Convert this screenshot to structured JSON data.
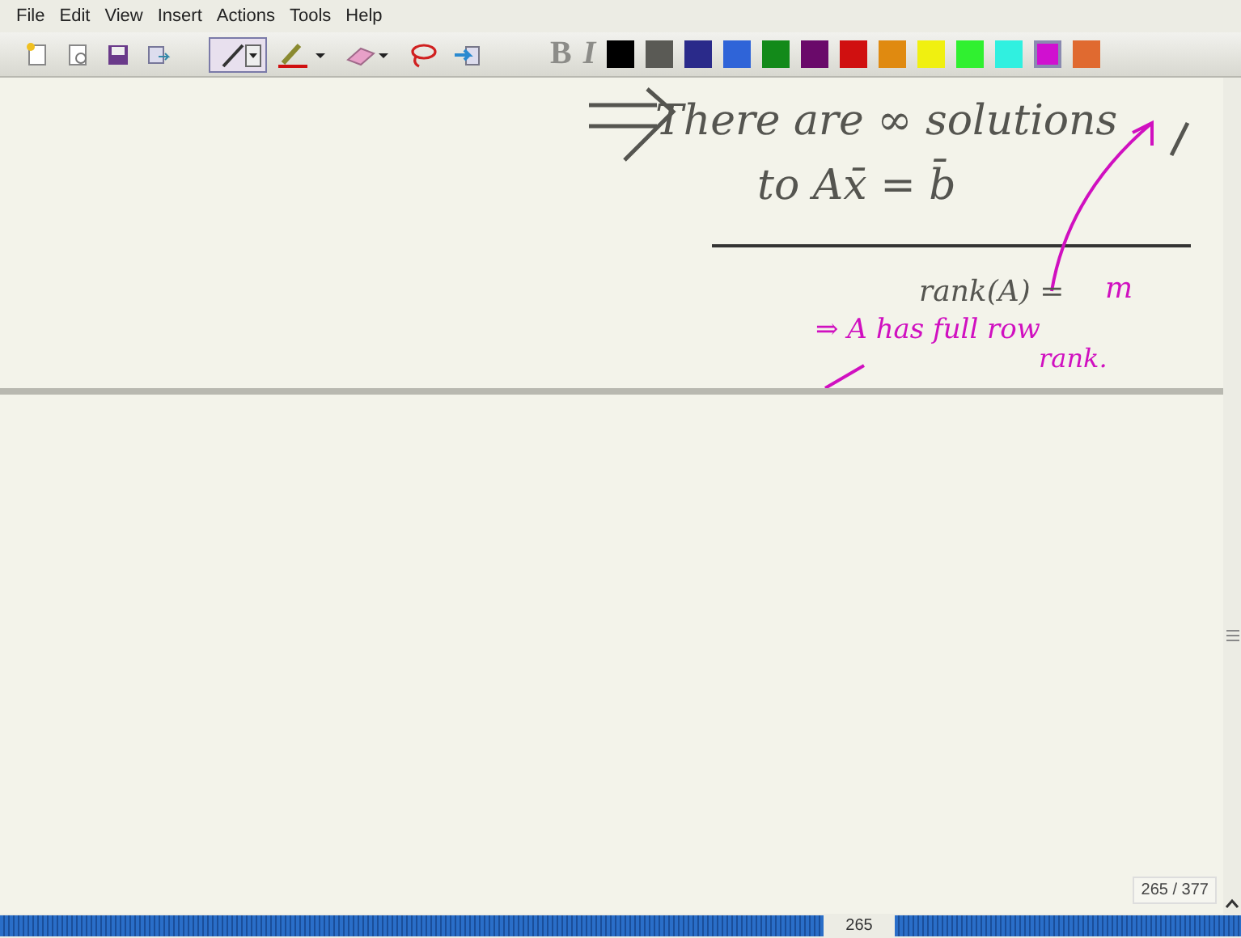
{
  "menu": [
    "File",
    "Edit",
    "View",
    "Insert",
    "Actions",
    "Tools",
    "Help"
  ],
  "toolbar": {
    "tools": [
      {
        "kind": "new-note",
        "selected": false
      },
      {
        "kind": "new-page",
        "selected": false
      },
      {
        "kind": "save",
        "selected": false
      },
      {
        "kind": "send",
        "selected": false
      },
      {
        "kind": "pen",
        "selected": true
      },
      {
        "kind": "highlighter",
        "selected": false
      },
      {
        "kind": "eraser",
        "selected": false
      },
      {
        "kind": "lasso",
        "selected": false
      },
      {
        "kind": "insert-space",
        "selected": false
      }
    ],
    "format": [
      {
        "label": "B",
        "disabled": true
      },
      {
        "label": "I",
        "disabled": true
      }
    ],
    "colors": [
      {
        "color": "#000000",
        "selected": false
      },
      {
        "color": "#5a5a55",
        "selected": false
      },
      {
        "color": "#2a2a8a",
        "selected": false
      },
      {
        "color": "#2f64d8",
        "selected": false
      },
      {
        "color": "#138a1a",
        "selected": false
      },
      {
        "color": "#6a0a6a",
        "selected": false
      },
      {
        "color": "#d01010",
        "selected": false
      },
      {
        "color": "#e08a10",
        "selected": false
      },
      {
        "color": "#f0f010",
        "selected": false
      },
      {
        "color": "#30f030",
        "selected": false
      },
      {
        "color": "#30f0e0",
        "selected": false
      },
      {
        "color": "#d010d0",
        "selected": true
      },
      {
        "color": "#e06a30",
        "selected": false
      }
    ]
  },
  "note": {
    "ink": [
      {
        "text": "There are ∞ solutions",
        "color": "#555550"
      },
      {
        "text": "to Ax̄ = b̄",
        "color": "#555550"
      },
      {
        "text": "rank(A) =",
        "color": "#555550"
      },
      {
        "text": "m",
        "color": "#d010c0"
      },
      {
        "text": "⇒ A has full row",
        "color": "#d010c0"
      },
      {
        "text": "rank.",
        "color": "#d010c0"
      }
    ],
    "page_badge": "265 / 377"
  },
  "status_bar": {
    "page": "265"
  }
}
